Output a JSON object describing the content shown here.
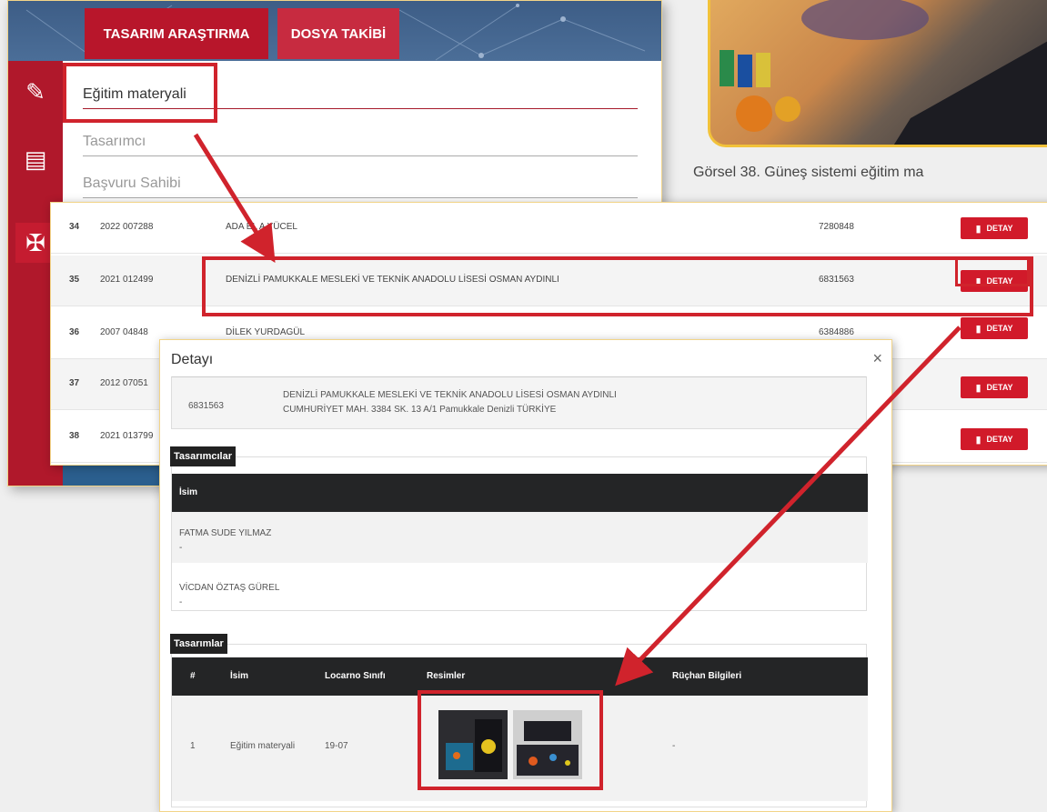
{
  "tabs": {
    "design_search": "TASARIM ARAŞTIRMA",
    "file_tracking": "DOSYA TAKİBİ"
  },
  "search": {
    "product_value": "Eğitim materyali",
    "designer_placeholder": "Tasarımcı",
    "applicant_placeholder": "Başvuru Sahibi"
  },
  "caption": "Görsel 38. Güneş sistemi eğitim ma",
  "results": {
    "rows": [
      {
        "no": "34",
        "app_no": "2022 007288",
        "owner": "ADA EL A YÜCEL",
        "code": "7280848",
        "action": "DETAY"
      },
      {
        "no": "35",
        "app_no": "2021 012499",
        "owner": "DENİZLİ PAMUKKALE MESLEKİ VE TEKNİK ANADOLU LİSESİ OSMAN AYDINLI",
        "code": "6831563",
        "action": "DETAY"
      },
      {
        "no": "36",
        "app_no": "2007 04848",
        "owner": "DİLEK YURDAGÜL",
        "code": "6384886",
        "action": "DETAY"
      },
      {
        "no": "37",
        "app_no": "2012 07051",
        "owner": "",
        "code": "",
        "action": "DETAY"
      },
      {
        "no": "38",
        "app_no": "2021 013799",
        "owner": "",
        "code": "",
        "action": "DETAY"
      }
    ]
  },
  "modal": {
    "title": "Detayı",
    "close": "×",
    "owner_code": "6831563",
    "owner_name": "DENİZLİ PAMUKKALE MESLEKİ VE TEKNİK ANADOLU LİSESİ OSMAN AYDINLI",
    "owner_address": "CUMHURİYET MAH. 3384 SK. 13 A/1 Pamukkale Denizli TÜRKİYE",
    "designers_label": "Tasarımcılar",
    "designers_header": "İsim",
    "designers": [
      {
        "name": "FATMA SUDE YILMAZ",
        "extra": "-"
      },
      {
        "name": "VİCDAN ÖZTAŞ GÜREL",
        "extra": "-"
      }
    ],
    "designs_label": "Tasarımlar",
    "designs_headers": {
      "num": "#",
      "name": "İsim",
      "locarno": "Locarno Sınıfı",
      "images": "Resimler",
      "priority": "Rüçhan Bilgileri"
    },
    "designs": [
      {
        "num": "1",
        "name": "Eğitim materyali",
        "locarno": "19-07",
        "priority": "-"
      }
    ]
  },
  "colors": {
    "accent": "#d11a2a",
    "sidebar": "#b0182b",
    "panel_bg": "#2b5f8e",
    "highlight": "#d0232c",
    "table_header": "#242526"
  }
}
